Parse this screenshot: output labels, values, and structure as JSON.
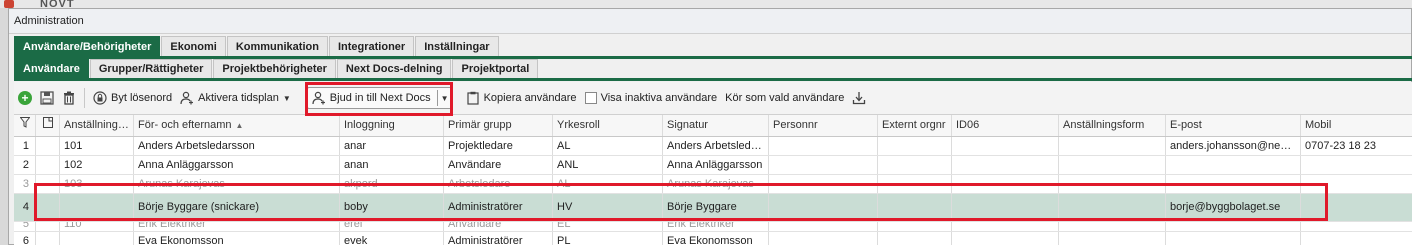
{
  "background_title": "NOVT",
  "window": {
    "title": "Administration"
  },
  "tabs_main": [
    {
      "label": "Användare/Behörigheter",
      "active": true
    },
    {
      "label": "Ekonomi",
      "active": false
    },
    {
      "label": "Kommunikation",
      "active": false
    },
    {
      "label": "Integrationer",
      "active": false
    },
    {
      "label": "Inställningar",
      "active": false
    }
  ],
  "tabs_sub": [
    {
      "label": "Användare",
      "active": true
    },
    {
      "label": "Grupper/Rättigheter",
      "active": false
    },
    {
      "label": "Projektbehörigheter",
      "active": false
    },
    {
      "label": "Next Docs-delning",
      "active": false
    },
    {
      "label": "Projektportal",
      "active": false
    }
  ],
  "toolbar": {
    "change_password": "Byt lösenord",
    "activate_schedule": "Aktivera tidsplan",
    "invite_next_docs": "Bjud in till Next Docs",
    "copy_users": "Kopiera användare",
    "show_inactive": "Visa inaktiva användare",
    "run_as_user": "Kör som vald användare"
  },
  "grid": {
    "columns": [
      "",
      "",
      "Anställningsnr",
      "För- och efternamn",
      "Inloggning",
      "Primär grupp",
      "Yrkesroll",
      "Signatur",
      "Personnr",
      "Externt orgnr",
      "ID06",
      "Anställningsform",
      "E-post",
      "Mobil"
    ],
    "rows": [
      [
        "1",
        "",
        "101",
        "Anders Arbetsledarsson",
        "anar",
        "Projektledare",
        "AL",
        "Anders Arbetsledars...",
        "",
        "",
        "",
        "",
        "anders.johansson@nextde...",
        "0707-23 18 23"
      ],
      [
        "2",
        "",
        "102",
        "Anna Anläggarsson",
        "anan",
        "Användare",
        "ANL",
        "Anna Anläggarsson",
        "",
        "",
        "",
        "",
        "",
        ""
      ],
      [
        "3",
        "",
        "103",
        "Arunas Karajevas",
        "akpord",
        "Arbetsledare",
        "AL",
        "Arunas Karajevas",
        "",
        "",
        "",
        "",
        "",
        ""
      ],
      [
        "4",
        "",
        "",
        "Börje Byggare (snickare)",
        "boby",
        "Administratörer",
        "HV",
        "Börje Byggare",
        "",
        "",
        "",
        "",
        "borje@byggbolaget.se",
        ""
      ],
      [
        "5",
        "",
        "110",
        "Erik Elektriker",
        "erel",
        "Användare",
        "EL",
        "Erik Elektriker",
        "",
        "",
        "",
        "",
        "",
        ""
      ],
      [
        "6",
        "",
        "",
        "Eva Ekonomsson",
        "evek",
        "Administratörer",
        "PL",
        "Eva Ekonomsson",
        "",
        "",
        "",
        "",
        "",
        ""
      ]
    ],
    "selected_row": 3
  },
  "colors": {
    "accent": "#1b6b46",
    "highlight": "#e0192a",
    "selected": "#c9ddd4"
  }
}
